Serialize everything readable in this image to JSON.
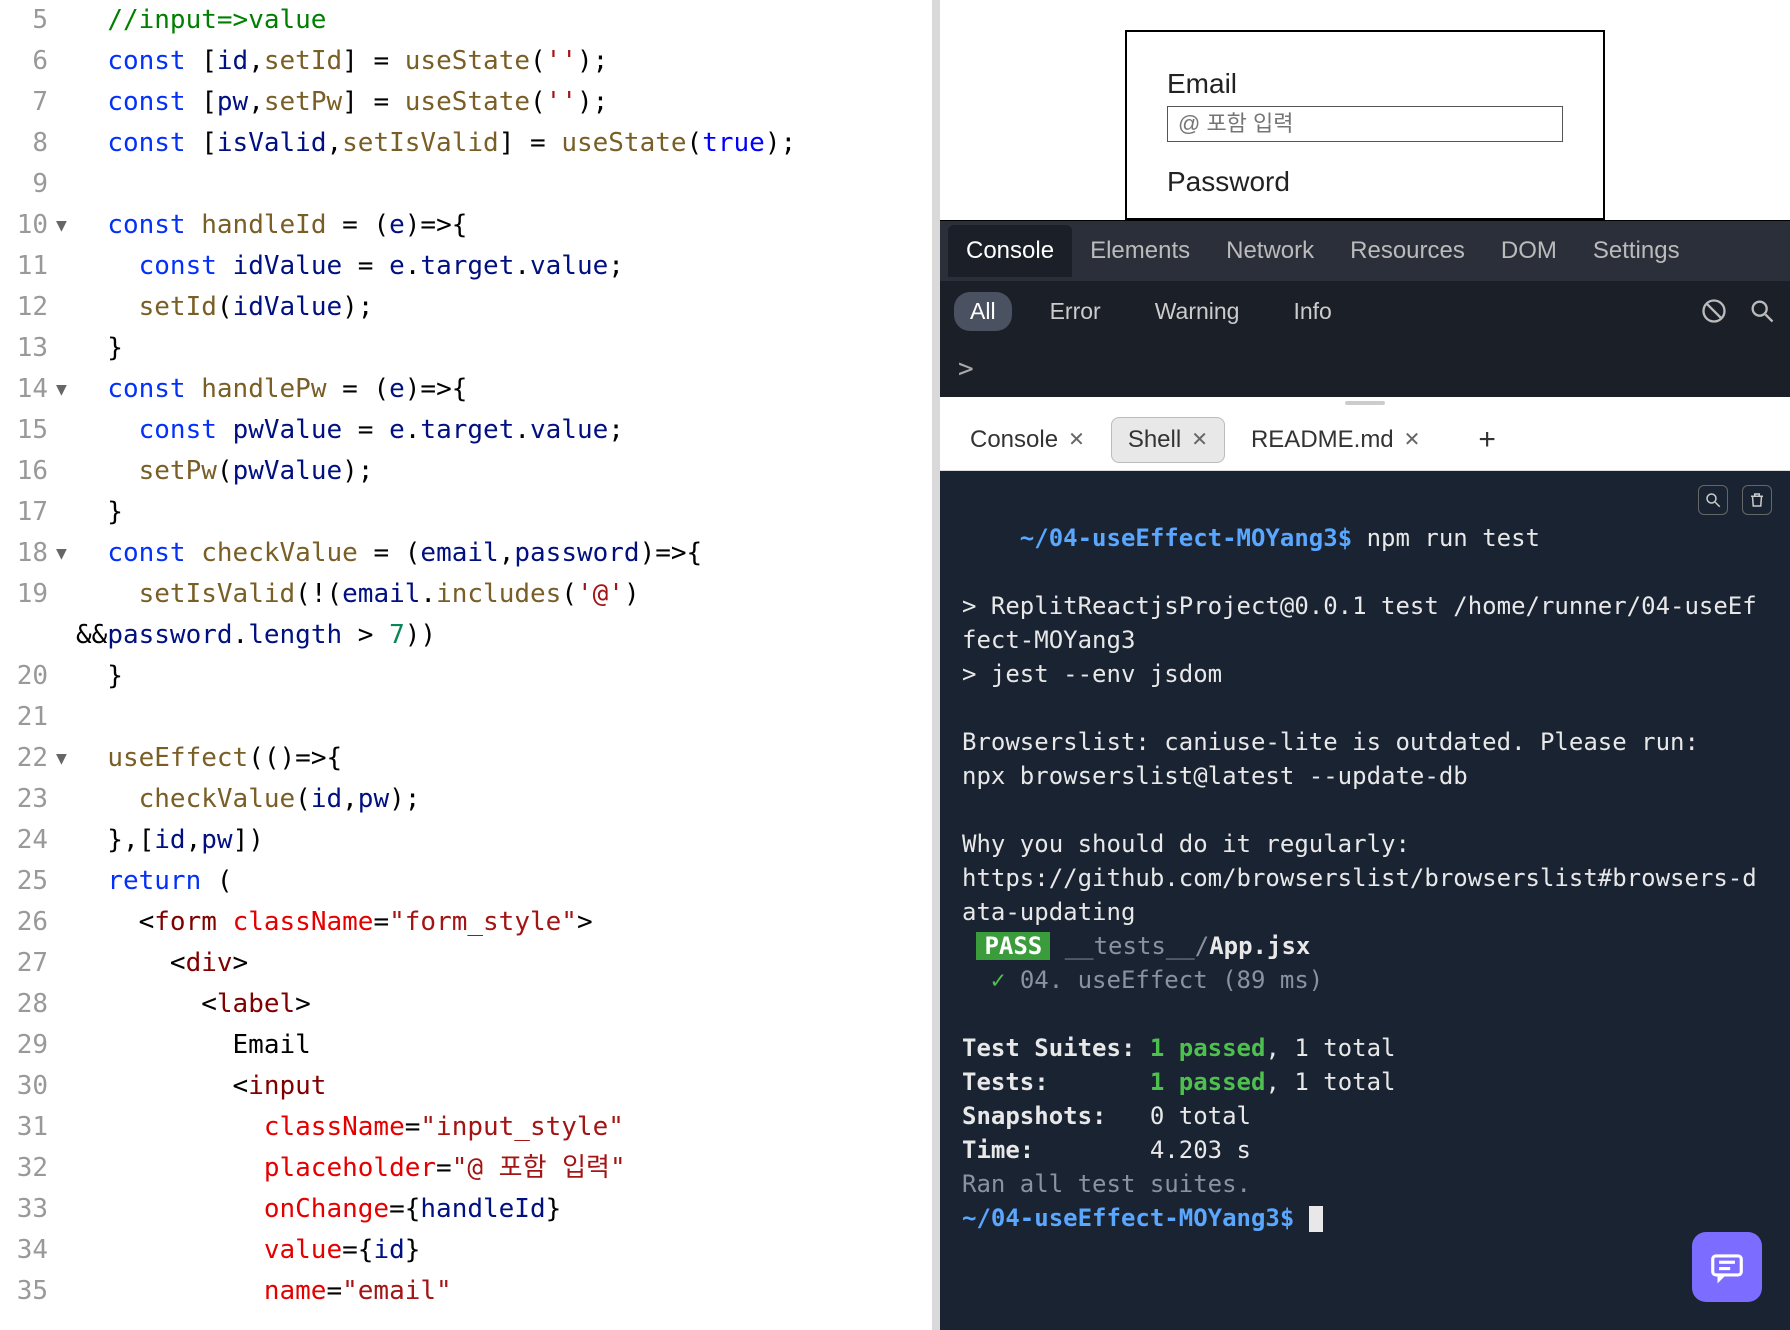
{
  "editor": {
    "lines": [
      {
        "num": 5,
        "fold": "",
        "html": "<span class='c-cmt'>//input=&gt;value</span>"
      },
      {
        "num": 6,
        "fold": "",
        "html": "<span class='c-kw'>const</span> [<span class='c-prop'>id</span>,<span class='c-fn'>setId</span>] = <span class='c-fn'>useState</span>(<span class='c-str'>''</span>);"
      },
      {
        "num": 7,
        "fold": "",
        "html": "<span class='c-kw'>const</span> [<span class='c-prop'>pw</span>,<span class='c-fn'>setPw</span>] = <span class='c-fn'>useState</span>(<span class='c-str'>''</span>);"
      },
      {
        "num": 8,
        "fold": "",
        "html": "<span class='c-kw'>const</span> [<span class='c-prop'>isValid</span>,<span class='c-fn'>setIsValid</span>] = <span class='c-fn'>useState</span>(<span class='c-bool'>true</span>);"
      },
      {
        "num": 9,
        "fold": "",
        "html": ""
      },
      {
        "num": 10,
        "fold": "▼",
        "html": "<span class='c-kw'>const</span> <span class='c-fn'>handleId</span> = (<span class='c-prop'>e</span>)=&gt;{"
      },
      {
        "num": 11,
        "fold": "",
        "html": "  <span class='c-kw'>const</span> <span class='c-prop'>idValue</span> = <span class='c-prop'>e</span>.<span class='c-prop'>target</span>.<span class='c-prop'>value</span>;"
      },
      {
        "num": 12,
        "fold": "",
        "html": "  <span class='c-fn'>setId</span>(<span class='c-prop'>idValue</span>);"
      },
      {
        "num": 13,
        "fold": "",
        "html": "}"
      },
      {
        "num": 14,
        "fold": "▼",
        "html": "<span class='c-kw'>const</span> <span class='c-fn'>handlePw</span> = (<span class='c-prop'>e</span>)=&gt;{"
      },
      {
        "num": 15,
        "fold": "",
        "html": "  <span class='c-kw'>const</span> <span class='c-prop'>pwValue</span> = <span class='c-prop'>e</span>.<span class='c-prop'>target</span>.<span class='c-prop'>value</span>;"
      },
      {
        "num": 16,
        "fold": "",
        "html": "  <span class='c-fn'>setPw</span>(<span class='c-prop'>pwValue</span>);"
      },
      {
        "num": 17,
        "fold": "",
        "html": "}"
      },
      {
        "num": 18,
        "fold": "▼",
        "html": "<span class='c-kw'>const</span> <span class='c-fn'>checkValue</span> = (<span class='c-prop'>email</span>,<span class='c-prop'>password</span>)=&gt;{"
      },
      {
        "num": 19,
        "fold": "",
        "html": "  <span class='c-fn'>setIsValid</span>(!(<span class='c-prop'>email</span>.<span class='c-fn'>includes</span>(<span class='c-str'>'@'</span>)",
        "wrap": "&amp;&amp;<span class='c-prop'>password</span>.<span class='c-prop'>length</span> &gt; <span class='c-num'>7</span>))"
      },
      {
        "num": 20,
        "fold": "",
        "html": "}"
      },
      {
        "num": 21,
        "fold": "",
        "html": ""
      },
      {
        "num": 22,
        "fold": "▼",
        "html": "<span class='c-fn'>useEffect</span>(()=&gt;{"
      },
      {
        "num": 23,
        "fold": "",
        "html": "  <span class='c-fn'>checkValue</span>(<span class='c-prop'>id</span>,<span class='c-prop'>pw</span>);"
      },
      {
        "num": 24,
        "fold": "",
        "html": "},[<span class='c-prop'>id</span>,<span class='c-prop'>pw</span>])"
      },
      {
        "num": 25,
        "fold": "",
        "html": "<span class='c-kw'>return</span> ("
      },
      {
        "num": 26,
        "fold": "",
        "html": "  &lt;<span class='c-tag'>form</span> <span class='c-attr'>className</span>=<span class='c-str'>\"form_style\"</span>&gt;"
      },
      {
        "num": 27,
        "fold": "",
        "html": "    &lt;<span class='c-tag'>div</span>&gt;"
      },
      {
        "num": 28,
        "fold": "",
        "html": "      &lt;<span class='c-tag'>label</span>&gt;"
      },
      {
        "num": 29,
        "fold": "",
        "html": "        Email"
      },
      {
        "num": 30,
        "fold": "",
        "html": "        &lt;<span class='c-tag'>input</span>"
      },
      {
        "num": 31,
        "fold": "",
        "html": "          <span class='c-attr'>className</span>=<span class='c-str'>\"input_style\"</span>"
      },
      {
        "num": 32,
        "fold": "",
        "html": "          <span class='c-attr'>placeholder</span>=<span class='c-str'>\"@ 포함 입력\"</span>"
      },
      {
        "num": 33,
        "fold": "",
        "html": "          <span class='c-attr'>onChange</span>={<span class='c-prop'>handleId</span>}"
      },
      {
        "num": 34,
        "fold": "",
        "html": "          <span class='c-attr'>value</span>={<span class='c-prop'>id</span>}"
      },
      {
        "num": 35,
        "fold": "",
        "html": "          <span class='c-attr'>name</span>=<span class='c-str'>\"email\"</span>"
      }
    ]
  },
  "preview": {
    "email_label": "Email",
    "email_placeholder": "@ 포함 입력",
    "password_label": "Password"
  },
  "devtools": {
    "tabs": [
      "Console",
      "Elements",
      "Network",
      "Resources",
      "DOM",
      "Settings"
    ],
    "active_tab": 0,
    "filters": [
      "All",
      "Error",
      "Warning",
      "Info"
    ],
    "active_filter": 0,
    "prompt": ">"
  },
  "bottom_tabs": {
    "items": [
      {
        "label": "Console",
        "closable": true,
        "active": false
      },
      {
        "label": "Shell",
        "closable": true,
        "active": true
      },
      {
        "label": "README.md",
        "closable": true,
        "active": false
      }
    ]
  },
  "terminal": {
    "cwd": "~/04-useEffect-MOYang3",
    "command": "npm run test",
    "out1": "> ReplitReactjsProject@0.0.1 test /home/runner/04-useEffect-MOYang3",
    "out2": "> jest --env jsdom",
    "out3": "Browserslist: caniuse-lite is outdated. Please run:",
    "out4": "npx browserslist@latest --update-db",
    "out5": "Why you should do it regularly:",
    "out6": "https://github.com/browserslist/browserslist#browsers-data-updating",
    "pass": "PASS",
    "test_file_dir": "__tests__/",
    "test_file": "App.jsx",
    "test_case": "04. useEffect (89 ms)",
    "suites_label": "Test Suites:",
    "suites_pass": "1 passed",
    "suites_total": ", 1 total",
    "tests_label": "Tests:",
    "tests_pass": "1 passed",
    "tests_total": ", 1 total",
    "snap_label": "Snapshots:",
    "snap_val": "0 total",
    "time_label": "Time:",
    "time_val": "4.203 s",
    "ran": "Ran all test suites."
  }
}
